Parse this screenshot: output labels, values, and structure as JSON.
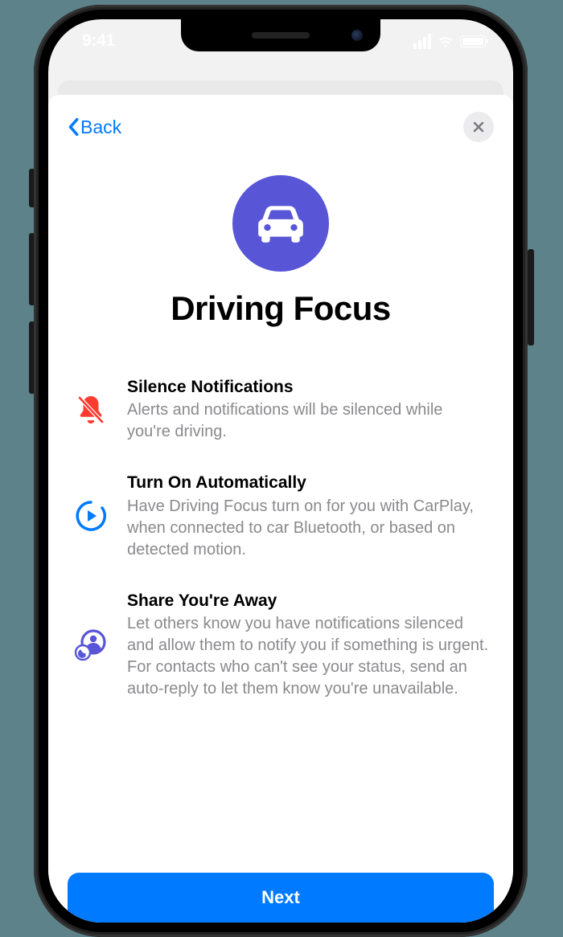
{
  "status": {
    "time": "9:41"
  },
  "sheet": {
    "back_label": "Back",
    "title": "Driving Focus",
    "next_label": "Next"
  },
  "features": [
    {
      "title": "Silence Notifications",
      "desc": "Alerts and notifications will be silenced while you're driving."
    },
    {
      "title": "Turn On Automatically",
      "desc": "Have Driving Focus turn on for you with CarPlay, when connected to car Bluetooth, or based on detected motion."
    },
    {
      "title": "Share You're Away",
      "desc": "Let others know you have notifications silenced and allow them to notify you if something is urgent. For contacts who can't see your status, send an auto-reply to let them know you're unavailable."
    }
  ],
  "colors": {
    "accent": "#007aff",
    "focus_purple": "#5856d6",
    "danger": "#ff3b30",
    "muted": "#8a8a8e"
  }
}
